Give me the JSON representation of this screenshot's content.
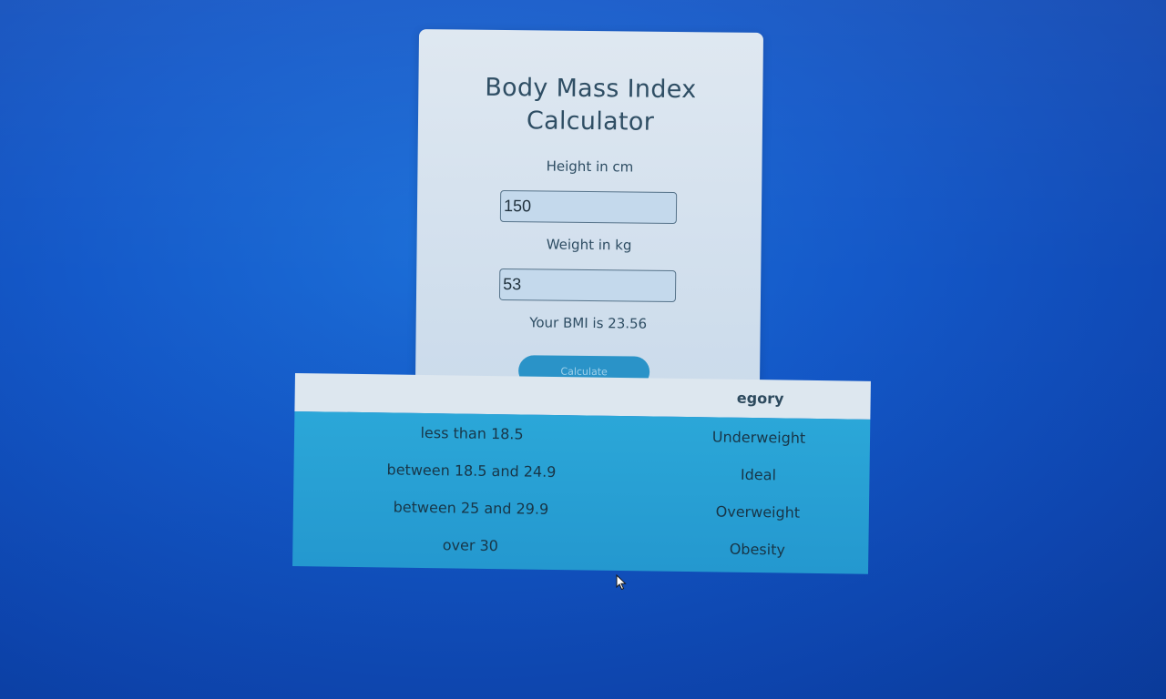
{
  "calculator": {
    "title": "Body Mass Index Calculator",
    "height_label": "Height in cm",
    "height_value": "150",
    "weight_label": "Weight in kg",
    "weight_value": "53",
    "result_text": "Your BMI is 23.56",
    "calculate_label": "Calculate"
  },
  "bmi_table": {
    "header_category": "egory",
    "rows": [
      {
        "range": "less than 18.5",
        "category": "Underweight"
      },
      {
        "range": "between 18.5 and 24.9",
        "category": "Ideal"
      },
      {
        "range": "between 25 and 29.9",
        "category": "Overweight"
      },
      {
        "range": "over 30",
        "category": "Obesity"
      }
    ]
  },
  "colors": {
    "background": "#1459c9",
    "card": "#d6e2ee",
    "table_body": "#2ba7d8",
    "button": "#2a93c8"
  },
  "icons": {
    "cursor": "mouse-pointer-icon"
  }
}
